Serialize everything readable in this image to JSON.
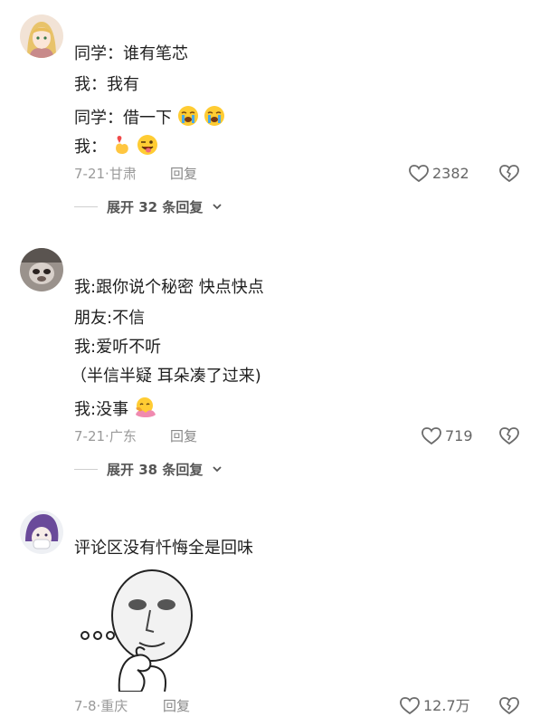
{
  "comments": [
    {
      "lines": [
        "同学：谁有笔芯",
        "我：我有",
        "同学：借一下",
        "我："
      ],
      "date": "7-21",
      "location": "甘肃",
      "reply_label": "回复",
      "likes": "2382",
      "expand_label": "展开 32 条回复",
      "icons": [
        "crying-face-emoji",
        "crying-face-emoji",
        "heart-hands-emoji",
        "winking-tongue-emoji"
      ]
    },
    {
      "lines": [
        "我:跟你说个秘密 快点快点",
        "朋友:不信",
        "我:爱听不听",
        "（半信半疑 耳朵凑了过来)",
        "我:没事"
      ],
      "date": "7-21",
      "location": "广东",
      "reply_label": "回复",
      "likes": "719",
      "expand_label": "展开 38 条回复",
      "icons": [
        "hugging-face-emoji"
      ]
    },
    {
      "lines": [
        "评论区没有忏悔全是回味"
      ],
      "date": "7-8",
      "location": "重庆",
      "reply_label": "回复",
      "likes": "12.7万",
      "icons": [
        "thinking-meme-sticker"
      ]
    }
  ],
  "separator": "·",
  "colors": {
    "text": "#1f1f1f",
    "meta": "#9a9a9a",
    "icon": "#6b6b6b",
    "background": "#ffffff"
  }
}
